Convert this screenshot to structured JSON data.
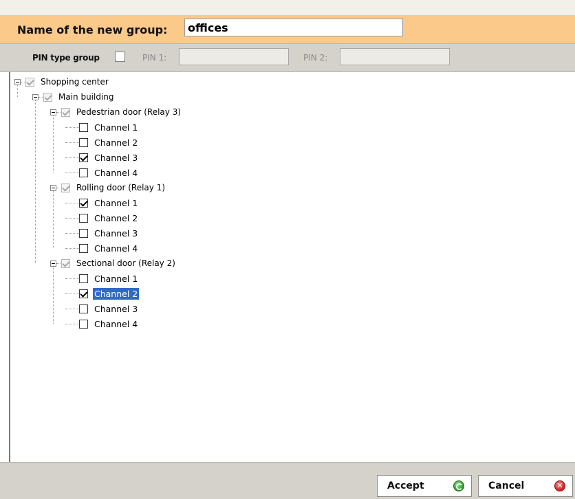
{
  "name_section": {
    "label": "Name of the new group:",
    "value": "offices"
  },
  "pin_section": {
    "pin_type_label": "PIN type group",
    "pin_type_checked": false,
    "pin1_label": "PIN 1:",
    "pin1_value": "",
    "pin2_label": "PIN 2:",
    "pin2_value": ""
  },
  "tree": {
    "root": {
      "label": "Shopping center",
      "children": [
        {
          "label": "Main building",
          "children": [
            {
              "label": "Pedestrian door (Relay 3)",
              "channels": [
                {
                  "label": "Channel 1",
                  "checked": false
                },
                {
                  "label": "Channel 2",
                  "checked": false
                },
                {
                  "label": "Channel 3",
                  "checked": true
                },
                {
                  "label": "Channel 4",
                  "checked": false
                }
              ]
            },
            {
              "label": "Rolling door (Relay 1)",
              "channels": [
                {
                  "label": "Channel 1",
                  "checked": true
                },
                {
                  "label": "Channel 2",
                  "checked": false
                },
                {
                  "label": "Channel 3",
                  "checked": false
                },
                {
                  "label": "Channel 4",
                  "checked": false
                }
              ]
            },
            {
              "label": "Sectional door (Relay 2)",
              "channels": [
                {
                  "label": "Channel 1",
                  "checked": false
                },
                {
                  "label": "Channel 2",
                  "checked": true,
                  "selected": true
                },
                {
                  "label": "Channel 3",
                  "checked": false
                },
                {
                  "label": "Channel 4",
                  "checked": false
                }
              ]
            }
          ]
        }
      ]
    }
  },
  "footer": {
    "accept_label": "Accept",
    "cancel_label": "Cancel",
    "accept_icon": "green-accept-icon",
    "cancel_icon": "red-cancel-icon"
  }
}
